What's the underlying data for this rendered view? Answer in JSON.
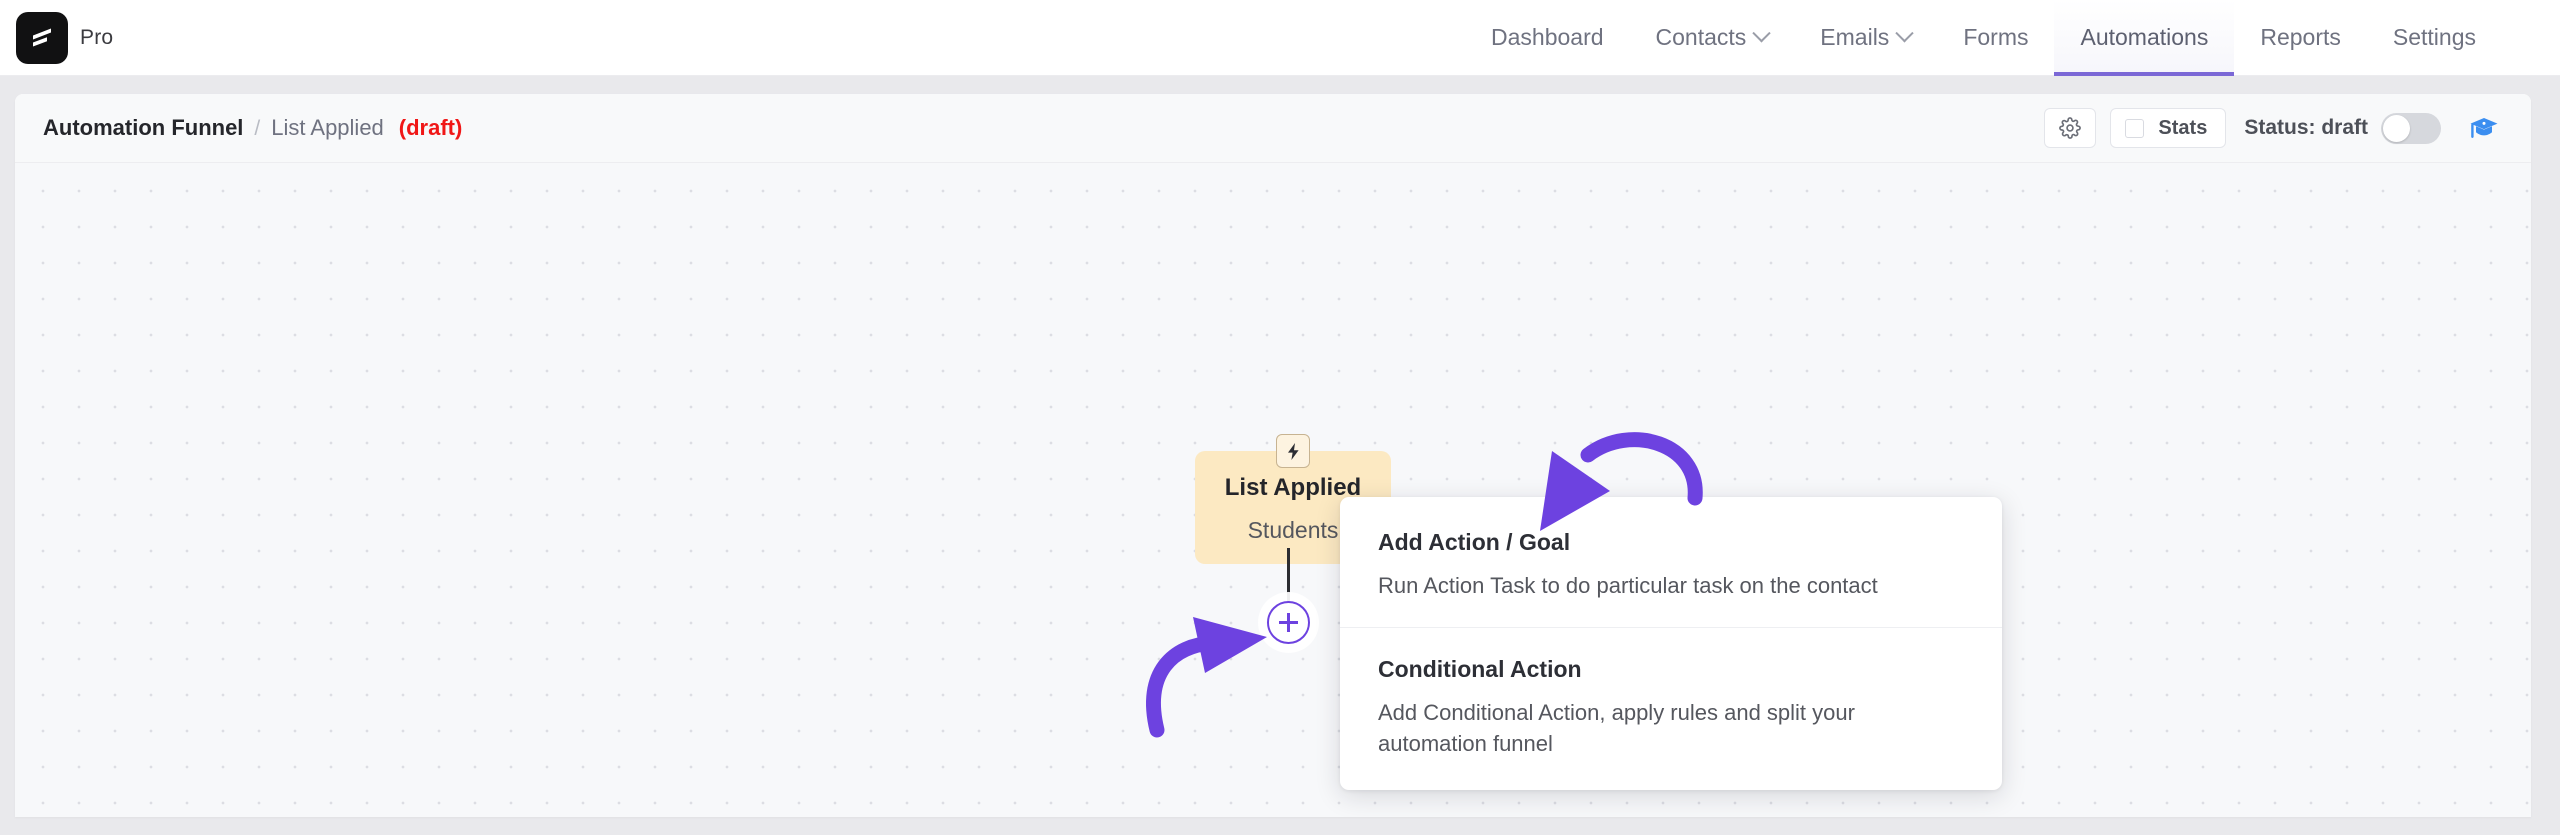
{
  "brand": {
    "logo_icon": "flow-logo-icon",
    "plan_label": "Pro"
  },
  "nav": {
    "items": [
      {
        "label": "Dashboard",
        "has_caret": false,
        "active": false
      },
      {
        "label": "Contacts",
        "has_caret": true,
        "active": false
      },
      {
        "label": "Emails",
        "has_caret": true,
        "active": false
      },
      {
        "label": "Forms",
        "has_caret": false,
        "active": false
      },
      {
        "label": "Automations",
        "has_caret": false,
        "active": true
      },
      {
        "label": "Reports",
        "has_caret": false,
        "active": false
      },
      {
        "label": "Settings",
        "has_caret": false,
        "active": false
      }
    ],
    "active_underline_color": "#7b68d6"
  },
  "header": {
    "breadcrumb": {
      "root": "Automation Funnel",
      "separator": "/",
      "name": "List Applied",
      "state": "(draft)",
      "state_color": "#f01616"
    },
    "settings_icon": "gear-icon",
    "stats": {
      "label": "Stats",
      "checked": false
    },
    "status": {
      "label": "Status: draft",
      "toggle_on": false,
      "toggle_track_color": "#d6d8dd"
    },
    "academy_icon": "graduation-cap-icon",
    "academy_icon_color": "#3b8ef0"
  },
  "canvas": {
    "trigger_node": {
      "badge_icon": "lightning-bolt-icon",
      "title": "List Applied",
      "subtitle": "Students",
      "background_color": "#fce9c2"
    },
    "add_button": {
      "icon": "plus-icon",
      "color": "#6d42e0"
    },
    "annotations": {
      "arrow_color": "#6d42e0",
      "arrow_to_popup": "curved-arrow-icon",
      "arrow_to_plus": "curved-arrow-icon"
    },
    "popup_menu": {
      "items": [
        {
          "title": "Add Action / Goal",
          "description": "Run Action Task to do particular task on the contact"
        },
        {
          "title": "Conditional Action",
          "description": "Add Conditional Action, apply rules and split your automation funnel"
        }
      ]
    }
  }
}
